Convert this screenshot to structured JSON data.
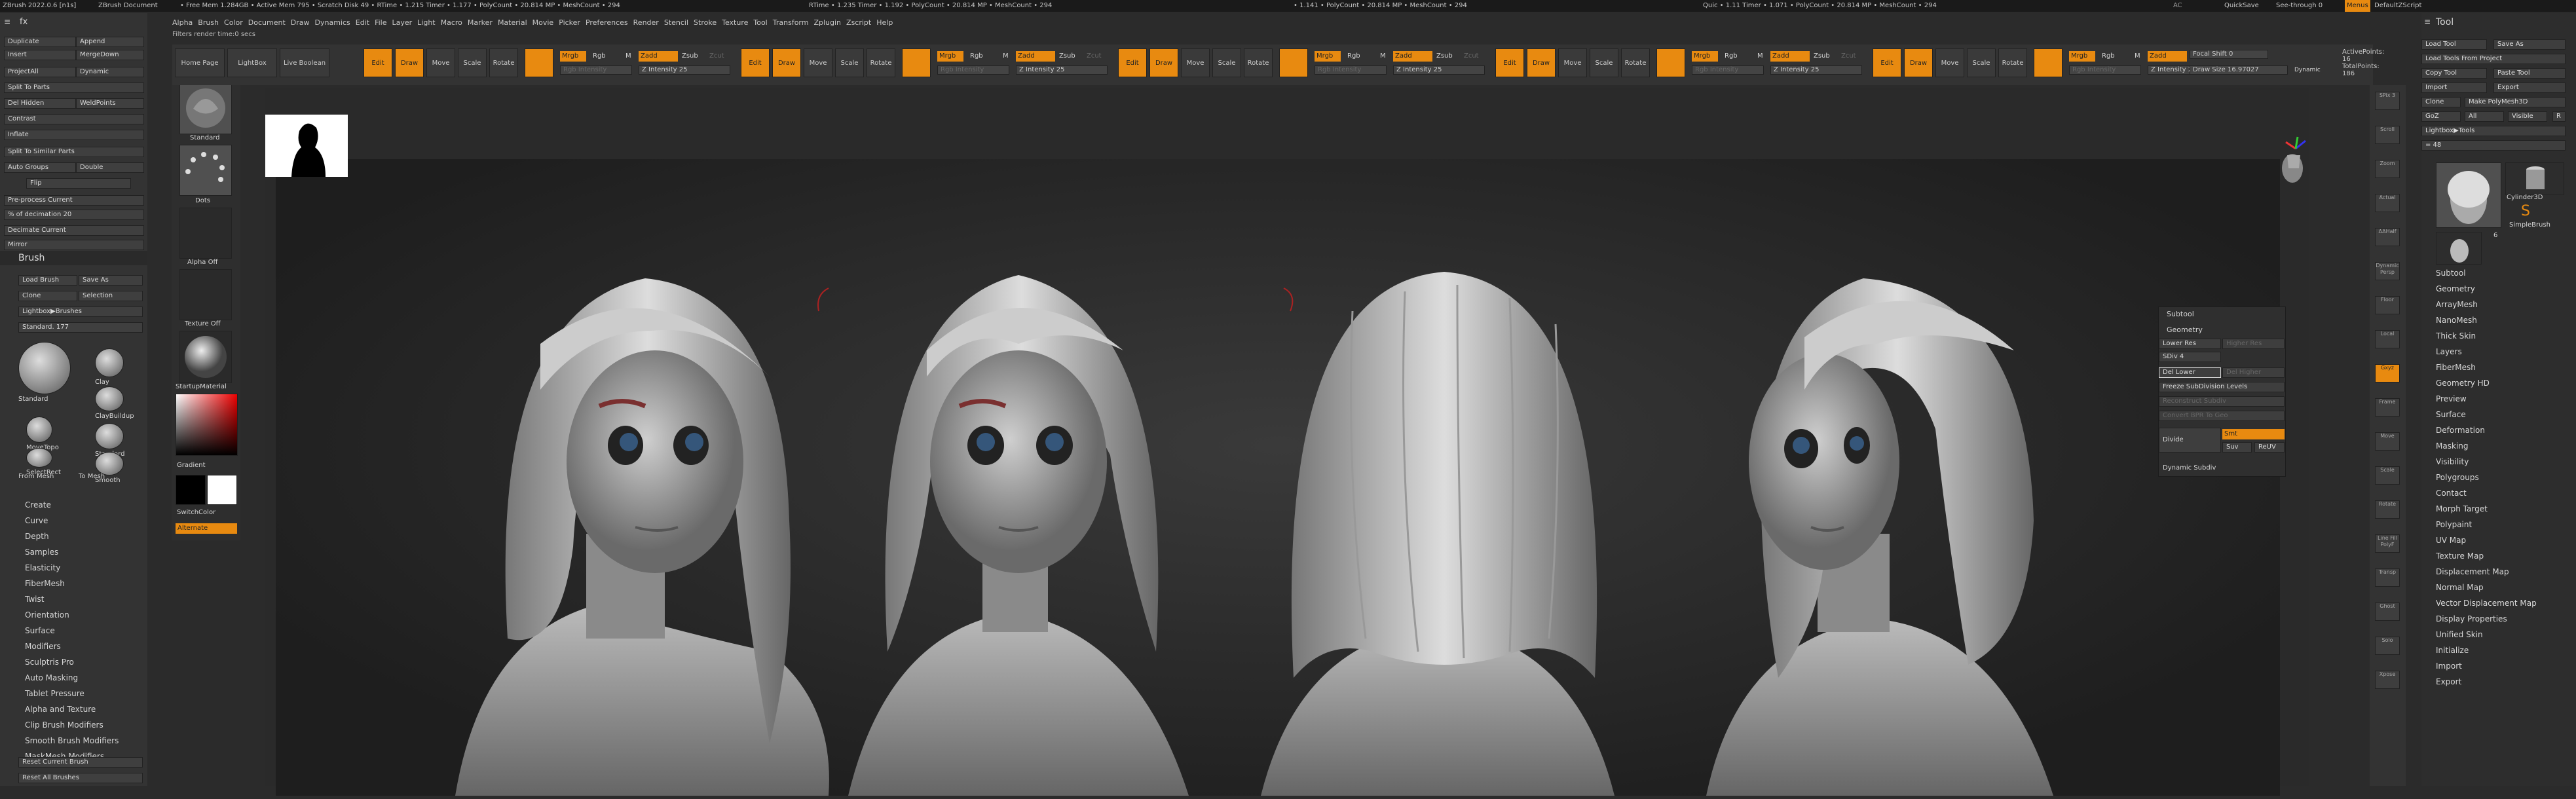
{
  "top_status": {
    "app": "ZBrush 2022.0.6 [n1s]",
    "doc": "ZBrush Document",
    "mem": "• Free Mem 1.284GB • Active Mem 795 • Scratch Disk 49 • RTime • 1.215 Timer • 1.177 • PolyCount • 20.814 MP • MeshCount • 294",
    "mem2": "• 1.141 • PolyCount • 20.814 MP • MeshCount • 294",
    "mem3": "RTime • 1.235 Timer • 1.192 • PolyCount • 20.814 MP • MeshCount • 294",
    "mem4": "Quic • 1.11 Timer • 1.071 • PolyCount • 20.814 MP • MeshCount • 294",
    "ac": "AC",
    "quicksave": "QuickSave",
    "seethrough": "See-through 0",
    "menus": "Menus",
    "defaultzscript": "DefaultZScript"
  },
  "menubar": [
    "Alpha",
    "Brush",
    "Color",
    "Document",
    "Draw",
    "Dynamics",
    "Edit",
    "File",
    "Layer",
    "Light",
    "Macro",
    "Marker",
    "Material",
    "Movie",
    "Picker",
    "Preferences",
    "Render",
    "Stencil",
    "Stroke",
    "Texture",
    "Tool",
    "Transform",
    "Zplugin",
    "Zscript",
    "Help"
  ],
  "filters_text": "Filters render time:0 secs",
  "left": {
    "fx": "fx",
    "buttons": [
      "Duplicate",
      "Append",
      "Insert",
      "MergeDown",
      "ProjectAll",
      "Dynamic",
      "Split To Parts",
      "Del Hidden",
      "WeldPoints",
      "Contrast",
      "Inflate",
      "Split To Similar Parts",
      "Auto Groups",
      "Double",
      "Flip",
      "Pre-process Current",
      "% of decimation 20",
      "Decimate Current",
      "Mirror"
    ],
    "brush_title": "Brush",
    "brush_buttons": [
      "Load Brush",
      "Save As",
      "Clone",
      "Selection",
      "Lightbox▶Brushes",
      "Standard. 177"
    ],
    "brushes": [
      "Standard",
      "Clay",
      "ClayBuildup",
      "MoveTopo",
      "Standard",
      "SelectRect",
      "Smooth",
      "From Mesh",
      "To Mesh"
    ],
    "create_list": [
      "Create",
      "Curve",
      "Depth",
      "Samples",
      "Elasticity",
      "FiberMesh",
      "Twist",
      "Orientation",
      "Surface",
      "Modifiers",
      "Sculptris Pro",
      "Auto Masking",
      "Tablet Pressure",
      "Alpha and Texture",
      "Clip Brush Modifiers",
      "Smooth Brush Modifiers",
      "MaskMesh Modifiers"
    ],
    "reset_current": "Reset Current Brush",
    "reset_all": "Reset All Brushes"
  },
  "left2": {
    "standard": "Standard",
    "dots": "Dots",
    "alpha_off": "Alpha Off",
    "texture_off": "Texture Off",
    "startupmaterial": "StartupMaterial",
    "gradient": "Gradient",
    "switchcolor": "SwitchColor",
    "alternate": "Alternate"
  },
  "toolbar": {
    "home": "Home Page",
    "lightbox": "LightBox",
    "live_boolean": "Live Boolean",
    "edit": "Edit",
    "draw": "Draw",
    "move": "Move",
    "scale": "Scale",
    "rotate": "Rotate",
    "mrgb": "Mrgb",
    "rgb": "Rgb",
    "m": "M",
    "zadd": "Zadd",
    "zsub": "Zsub",
    "zcut": "Zcut",
    "rgb_intensity": "Rgb Intensity",
    "z_intensity": "Z Intensity 25",
    "focal": "Focal Shift 0",
    "draw_size": "Draw Size 16",
    "draw_size2": "Draw Size 16.97027",
    "dynamic": "Dynamic",
    "active_points": "ActivePoints: 16",
    "total_points": "TotalPoints: 186"
  },
  "subtool": {
    "title": "Subtool",
    "geometry": "Geometry",
    "lower_res": "Lower Res",
    "higher_res": "Higher Res",
    "sdiv": "SDiv 4",
    "del_lower": "Del Lower",
    "del_higher": "Del Higher",
    "freeze": "Freeze SubDivision Levels",
    "reconstruct": "Reconstruct Subdiv",
    "convert": "Convert BPR To Geo",
    "divide": "Divide",
    "smt": "Smt",
    "suv": "Suv",
    "reuv": "ReUV",
    "dynamic_subdiv": "Dynamic Subdiv"
  },
  "right": {
    "tool": "Tool",
    "buttons": [
      "Load Tool",
      "Save As",
      "Load Tools From Project",
      "Copy Tool",
      "Paste Tool",
      "Import",
      "Export",
      "Clone",
      "Make PolyMesh3D",
      "GoZ",
      "All",
      "Visible",
      "R",
      "Lightbox▶Tools",
      "= 48"
    ],
    "tools": [
      "Cylinder3D",
      "SimpleBrush",
      "6"
    ],
    "menu": [
      "Subtool",
      "Geometry",
      "ArrayMesh",
      "NanoMesh",
      "Thick Skin",
      "Layers",
      "FiberMesh",
      "Geometry HD",
      "Preview",
      "Surface",
      "Deformation",
      "Masking",
      "Visibility",
      "Polygroups",
      "Contact",
      "Morph Target",
      "Polypaint",
      "UV Map",
      "Texture Map",
      "Displacement Map",
      "Normal Map",
      "Vector Displacement Map",
      "Display Properties",
      "Unified Skin",
      "Initialize",
      "Import",
      "Export"
    ]
  },
  "ricons": [
    "SPix 3",
    "Scroll",
    "Zoom",
    "Actual",
    "AAHalf",
    "Dynamic Persp",
    "Floor",
    "Local",
    "Gxyz",
    "Frame",
    "Move",
    "Scale",
    "Rotate",
    "Line Fill PolyF",
    "Transp",
    "Ghost",
    "Solo",
    "Xpose"
  ],
  "colors": {
    "accent": "#e88a10",
    "panel": "#333333",
    "dark": "#1a1a1a"
  }
}
